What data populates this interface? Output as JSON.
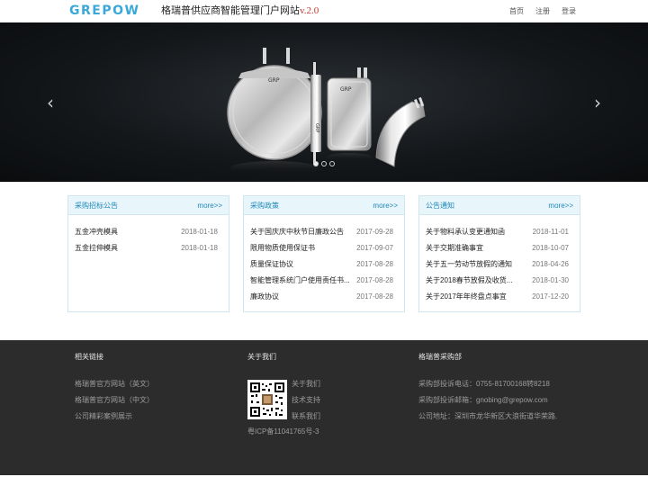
{
  "header": {
    "logo_text": "GREPOW",
    "title": "格瑞普供应商智能管理门户网站",
    "version": "v.2.0",
    "nav": [
      "首页",
      "注册",
      "登录"
    ]
  },
  "banner": {
    "prev_icon": "chevron-left-icon",
    "next_icon": "chevron-right-icon",
    "battery_label_1": "GRP",
    "battery_label_2": "GRP",
    "battery_label_3": "GRP"
  },
  "panels": [
    {
      "title": "采购招标公告",
      "more": "more>>",
      "items": [
        {
          "text": "五金冲壳模具",
          "date": "2018-01-18"
        },
        {
          "text": "五金拉伸模具",
          "date": "2018-01-18"
        }
      ]
    },
    {
      "title": "采购政策",
      "more": "more>>",
      "items": [
        {
          "text": "关于国庆庆中秋节日廉政公告",
          "date": "2017-09-28"
        },
        {
          "text": "限用物质使用保证书",
          "date": "2017-09-07"
        },
        {
          "text": "质量保证协议",
          "date": "2017-08-28"
        },
        {
          "text": "智能管理系统门户使用责任书...",
          "date": "2017-08-28"
        },
        {
          "text": "廉政协议",
          "date": "2017-08-28"
        }
      ]
    },
    {
      "title": "公告通知",
      "more": "more>>",
      "items": [
        {
          "text": "关于物料承认变更通知函",
          "date": "2018-11-01"
        },
        {
          "text": "关于交期准确事宜",
          "date": "2018-10-07"
        },
        {
          "text": "关于五一劳动节放假的通知",
          "date": "2018-04-26"
        },
        {
          "text": "关于2018春节放假及收货...",
          "date": "2018-01-30"
        },
        {
          "text": "关于2017年年终盘点事宜",
          "date": "2017-12-20"
        }
      ]
    }
  ],
  "footer": {
    "links_heading": "相关链接",
    "links": [
      "格瑞普官方网站（英文）",
      "格瑞普官方网站（中文）",
      "公司精彩案例展示"
    ],
    "about_heading": "关于我们",
    "about_links": [
      "关于我们",
      "技术支持",
      "联系我们"
    ],
    "icp": "粤ICP备11041765号-3",
    "dept_heading": "格瑞普采购部",
    "dept_lines": [
      "采购部投诉电话：0755-81700168转8218",
      "采购部投诉邮箱：gnobing@grepow.com",
      "公司地址：深圳市龙华新区大浪街道华荣路."
    ],
    "qr_icon": "qr-code-icon"
  },
  "colors": {
    "accent": "#3aa9d8",
    "panel_head_bg": "#e8f5fb",
    "footer_bg": "#2c2c2c",
    "version_red": "#c0392b"
  }
}
